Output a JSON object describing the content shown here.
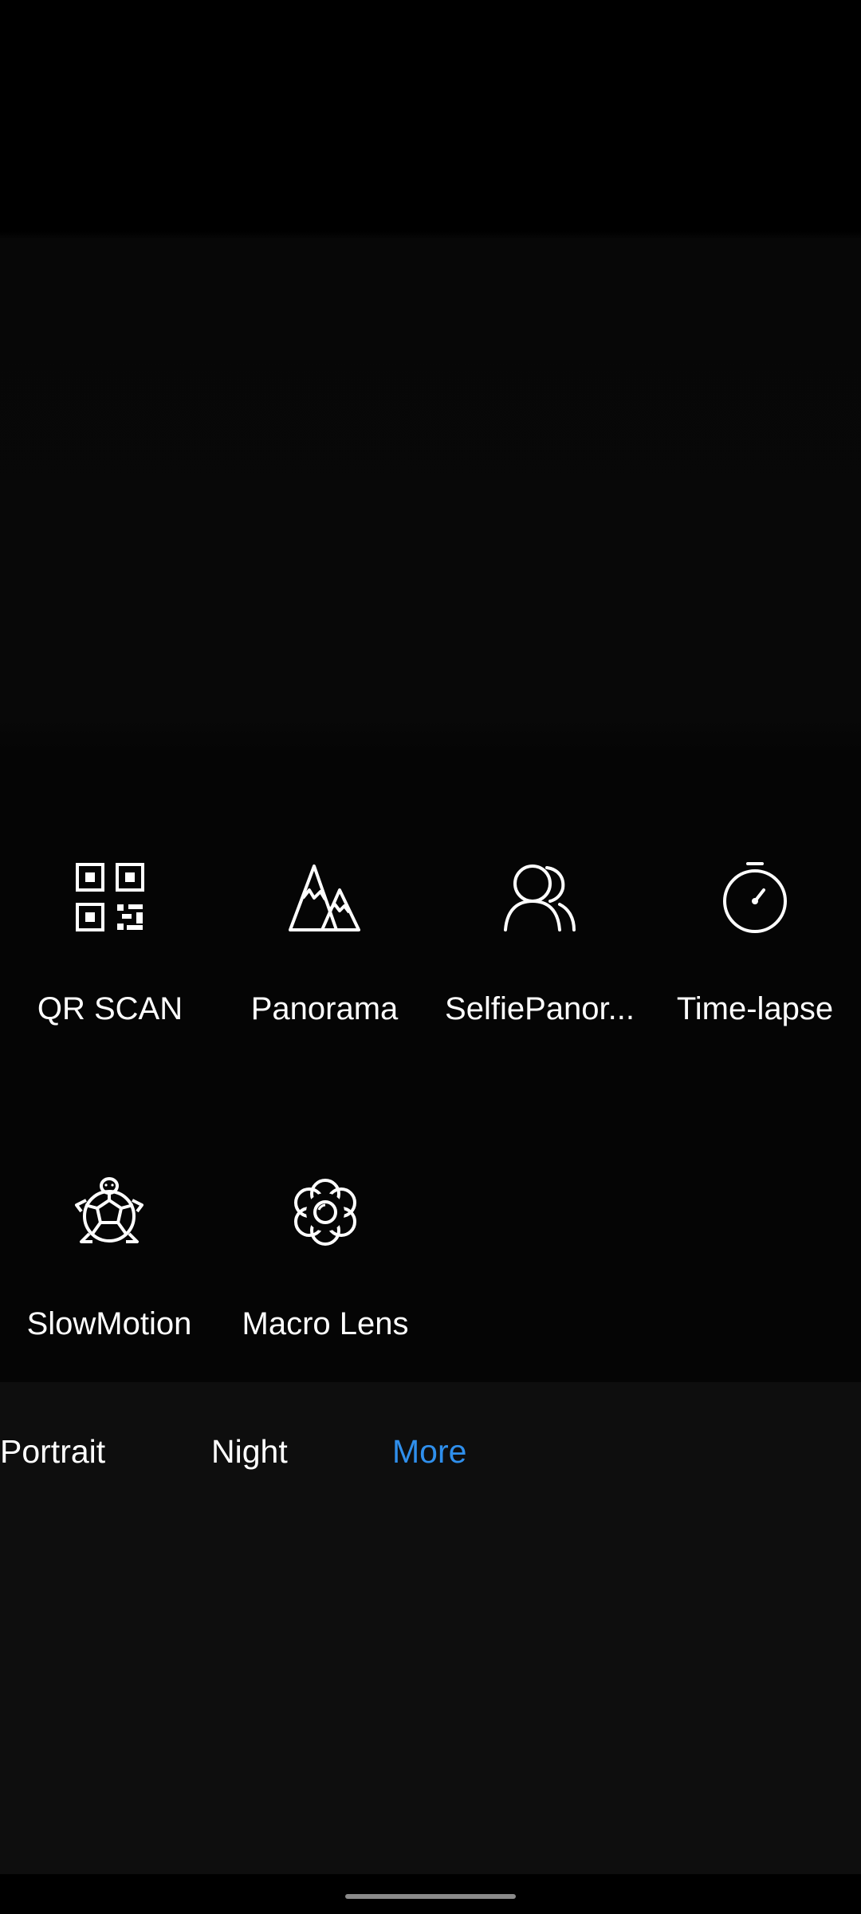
{
  "colors": {
    "background": "#000000",
    "tabbar_background": "#0e0e0e",
    "text": "#ffffff",
    "accent": "#2f8fec"
  },
  "modes": [
    {
      "label": "QR SCAN",
      "icon": "qr-code-icon"
    },
    {
      "label": "Panorama",
      "icon": "mountain-icon"
    },
    {
      "label": "SelfiePanor...",
      "icon": "people-icon"
    },
    {
      "label": "Time-lapse",
      "icon": "stopwatch-icon"
    },
    {
      "label": "SlowMotion",
      "icon": "turtle-icon"
    },
    {
      "label": "Macro Lens",
      "icon": "flower-icon"
    }
  ],
  "tabs": [
    {
      "label": "Portrait",
      "selected": false
    },
    {
      "label": "Night",
      "selected": false
    },
    {
      "label": "More",
      "selected": true
    }
  ]
}
